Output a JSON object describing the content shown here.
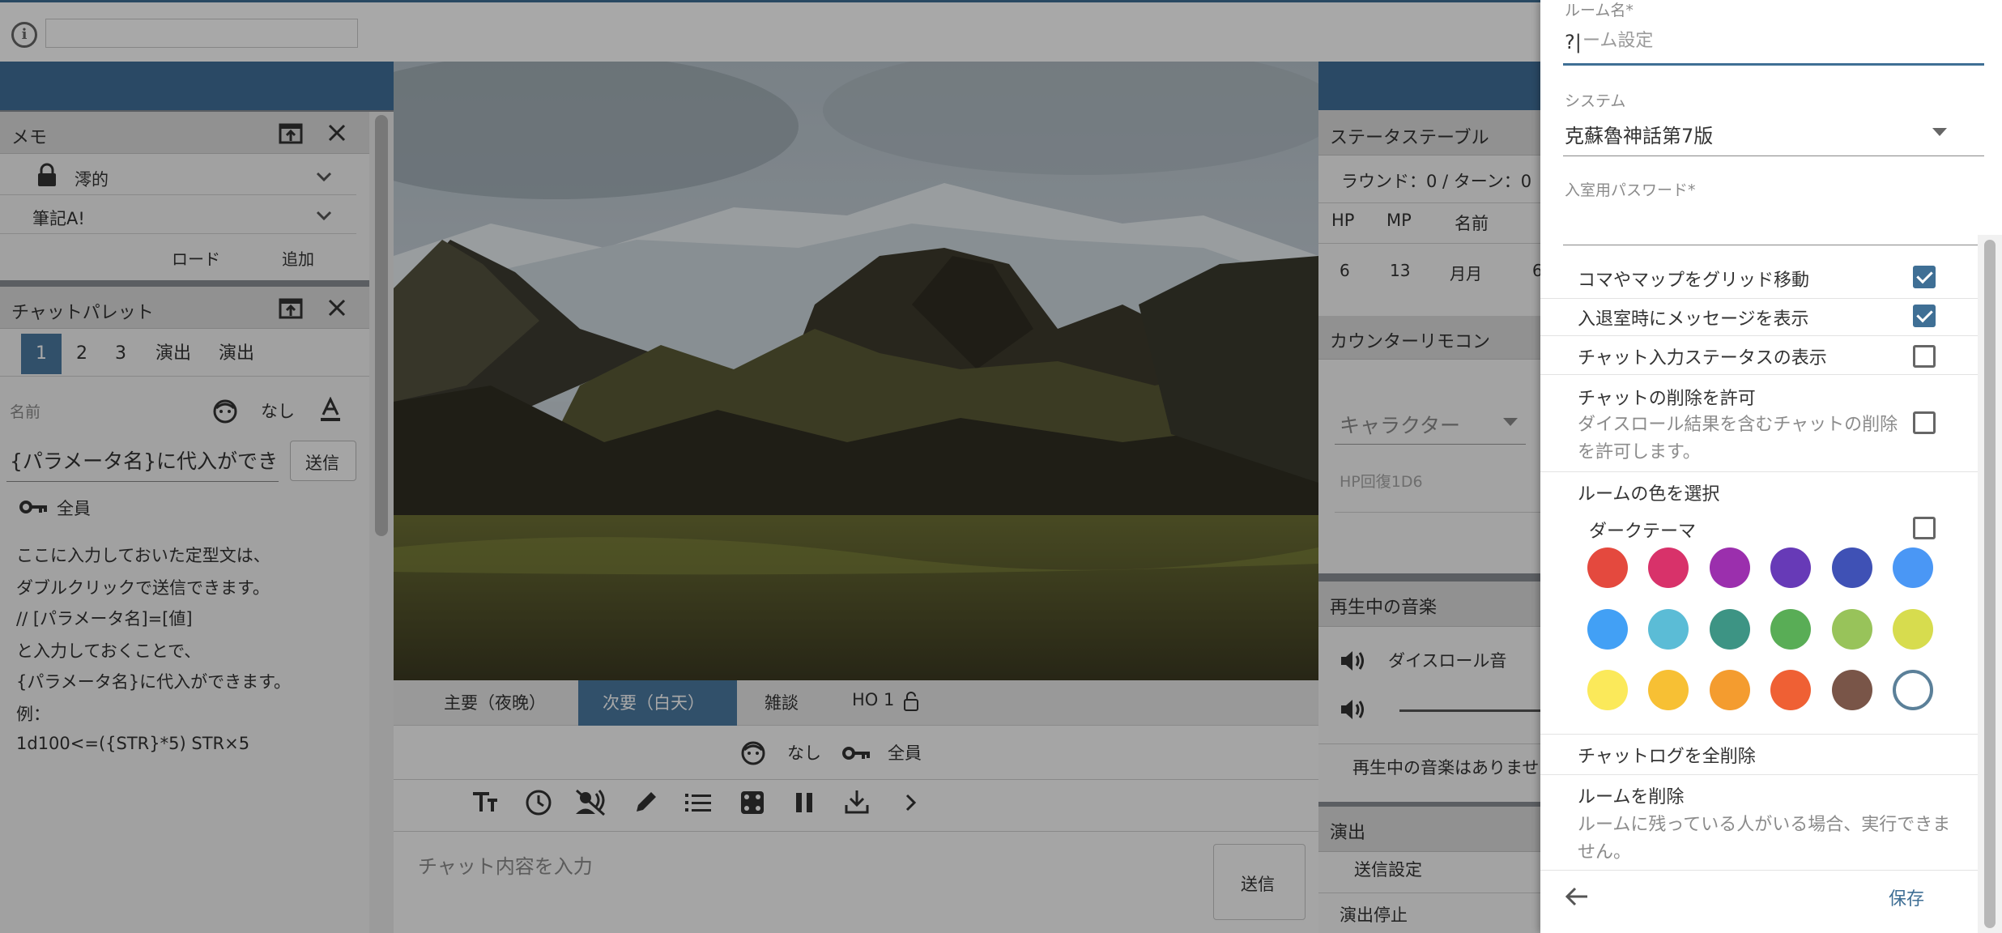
{
  "memo": {
    "title": "メモ",
    "items": [
      {
        "label": "澪的"
      },
      {
        "label": "筆記A!"
      }
    ],
    "load_label": "ロード",
    "add_label": "追加"
  },
  "palette": {
    "title": "チャットパレット",
    "tabs": [
      "1",
      "2",
      "3",
      "演出",
      "演出"
    ],
    "name_placeholder": "名前",
    "face_label": "なし",
    "input_value": "{パラメータ名}に代入ができま",
    "send_label": "送信",
    "target_label": "全員",
    "text_lines": [
      "ここに入力しておいた定型文は、",
      "ダブルクリックで送信できます。",
      "// [パラメータ名]=[値]",
      "と入力しておくことで、",
      "{パラメータ名}に代入ができます。",
      "例：",
      "1d100<=({STR}*5) STR×5"
    ]
  },
  "chat": {
    "tabs": [
      "主要（夜晚）",
      "次要（白天）",
      "雑談",
      "HO 1"
    ],
    "active_tab": 1,
    "face_label": "なし",
    "target_label": "全員",
    "placeholder": "チャット内容を入力",
    "send_label": "送信"
  },
  "status": {
    "title": "ステータステーブル",
    "round": "ラウンド：0 / ターン：0",
    "headers": [
      "HP",
      "MP",
      "名前"
    ],
    "row": [
      "6",
      "13",
      "月月",
      "6"
    ]
  },
  "counter": {
    "title": "カウンターリモコン",
    "character_placeholder": "キャラクター",
    "hint": "HP回復1D6"
  },
  "music": {
    "title": "再生中の音楽",
    "dice_label": "ダイスロール音",
    "none_label": "再生中の音楽はありませ"
  },
  "effect": {
    "title": "演出",
    "send_settings": "送信設定",
    "stop": "演出停止"
  },
  "settings": {
    "room_name_label": "ルーム名*",
    "room_name_value": "?|",
    "room_name_ghost": "ルーム設定",
    "system_label": "システム",
    "system_value": "克蘇魯神話第7版",
    "password_label": "入室用パスワード*",
    "grid_label": "コマやマップをグリッド移動",
    "grid_checked": true,
    "enter_msg_label": "入退室時にメッセージを表示",
    "enter_msg_checked": true,
    "chat_status_label": "チャット入力ステータスの表示",
    "chat_status_checked": false,
    "delete_chat_label": "チャットの削除を許可",
    "delete_chat_desc_1": "ダイスロール結果を含むチャットの削除",
    "delete_chat_desc_2": "を許可します。",
    "delete_chat_checked": false,
    "room_color_label": "ルームの色を選択",
    "dark_theme_label": "ダークテーマ",
    "dark_theme_checked": false,
    "colors": [
      "#e4493e",
      "#d8326a",
      "#9b2fad",
      "#673ab7",
      "#3f51b5",
      "#4a97f5",
      "#42a0f5",
      "#5bbcd6",
      "#3d9484",
      "#59ad56",
      "#98c35a",
      "#d7dc4e",
      "#fbe95a",
      "#f7c034",
      "#f49c2f",
      "#ef6034",
      "#795548",
      "#ffffff"
    ],
    "selected_color": 17,
    "clear_log_label": "チャットログを全削除",
    "delete_room_label": "ルームを削除",
    "delete_room_desc_1": "ルームに残っている人がいる場合、実行できま",
    "delete_room_desc_2": "せん。",
    "save_label": "保存"
  }
}
